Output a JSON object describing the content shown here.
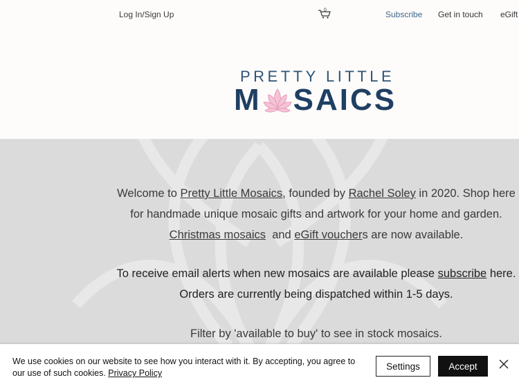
{
  "header": {
    "login_label": "Log In/Sign Up",
    "cart_count": "0",
    "nav": {
      "subscribe": "Subscribe",
      "get_in_touch": "Get in touch",
      "egift": "eGift"
    }
  },
  "logo": {
    "line1": "PRETTY LITTLE",
    "line2_start": "M",
    "line2_end": "SAICS"
  },
  "intro": {
    "welcome": "Welcome to ",
    "shop_link": "Pretty Little Mosaics",
    "founded_by": ", founded by ",
    "founder_link": "Rachel Soley",
    "in_year": " in 2020.  Shop here",
    "line2": "for handmade unique mosaic gifts and artwork for your home and garden.",
    "christmas_link": "Christmas mosaics",
    "and": "  and ",
    "egift_link": "eGift voucher",
    "available": "s are now available."
  },
  "alerts": {
    "line1_start": "To receive email alerts when new mosaics are available please ",
    "subscribe_link": "subscribe",
    "line1_end": " here.",
    "line2": "Orders are currently being dispatched within 1-5 days."
  },
  "filter_note": "Filter by 'available to buy' to see in stock mosaics.",
  "cookie": {
    "text": "We use cookies on our website to see how you interact with it. By accepting, you agree to our use of such cookies. ",
    "policy_link": "Privacy Policy",
    "settings_label": "Settings",
    "accept_label": "Accept"
  },
  "colors": {
    "brand_navy": "#1f3f63",
    "brand_blue": "#2f5377",
    "lotus_pink": "#f2b6cc",
    "band_grey": "#dbdbdb"
  }
}
